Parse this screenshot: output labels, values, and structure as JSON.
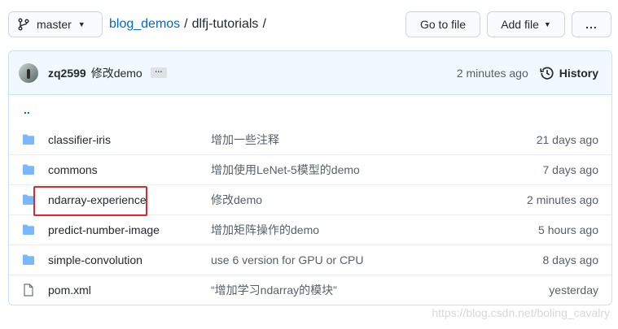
{
  "branch": {
    "label": "master"
  },
  "breadcrumb": {
    "repo": "blog_demos",
    "sep1": "/",
    "dir": "dlfj-tutorials",
    "sep2": "/"
  },
  "toolbar": {
    "go_to_file": "Go to file",
    "add_file": "Add file",
    "more": "..."
  },
  "commit": {
    "author": "zq2599",
    "message": "修改demo",
    "ellipsis": "…",
    "time": "2 minutes ago",
    "history": "History"
  },
  "files": {
    "parent": "..",
    "rows": [
      {
        "name": "classifier-iris",
        "message": "增加一些注释",
        "age": "21 days ago",
        "type": "folder"
      },
      {
        "name": "commons",
        "message": "增加使用LeNet-5模型的demo",
        "age": "7 days ago",
        "type": "folder"
      },
      {
        "name": "ndarray-experience",
        "message": "修改demo",
        "age": "2 minutes ago",
        "type": "folder"
      },
      {
        "name": "predict-number-image",
        "message": "增加矩阵操作的demo",
        "age": "5 hours ago",
        "type": "folder"
      },
      {
        "name": "simple-convolution",
        "message": "use 6 version for GPU or CPU",
        "age": "8 days ago",
        "type": "folder"
      },
      {
        "name": "pom.xml",
        "message": "“增加学习ndarray的模块”",
        "age": "yesterday",
        "type": "file"
      }
    ]
  },
  "watermark": "https://blog.csdn.net/boling_cavalry",
  "colors": {
    "link": "#0366d6",
    "folder": "#79b8ff",
    "highlight": "#e8242a"
  },
  "icons": {
    "branch": "git-branch-icon",
    "history": "history-icon",
    "folder": "folder-icon",
    "file": "file-icon"
  }
}
